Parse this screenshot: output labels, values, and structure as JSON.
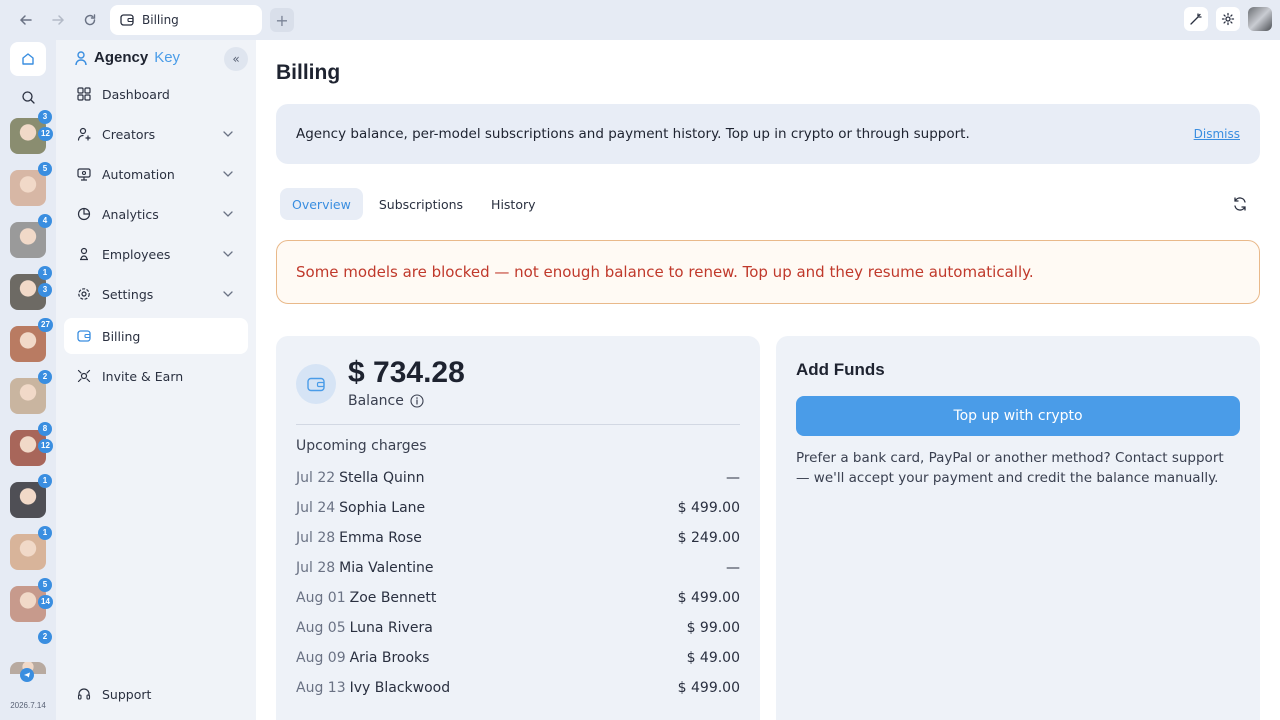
{
  "browser": {
    "tab_title": "Billing",
    "new_tab": "+"
  },
  "rail": {
    "version": "2026.7.14",
    "avatars": [
      {
        "badges": [
          "3",
          "12"
        ],
        "color": "#8a8d70"
      },
      {
        "badges": [
          "5"
        ],
        "color": "#d7b7a5"
      },
      {
        "badges": [
          "4"
        ],
        "color": "#9a9a9a"
      },
      {
        "badges": [
          "1",
          "3"
        ],
        "color": "#6d6a64"
      },
      {
        "badges": [
          "27"
        ],
        "color": "#b97b62"
      },
      {
        "badges": [
          "2"
        ],
        "color": "#c9b5a0"
      },
      {
        "badges": [
          "8",
          "12"
        ],
        "color": "#a8665a"
      },
      {
        "badges": [
          "1"
        ],
        "color": "#4f4f55"
      },
      {
        "badges": [
          "1"
        ],
        "color": "#d8b49a"
      },
      {
        "badges": [
          "5",
          "14"
        ],
        "color": "#c79a8c"
      },
      {
        "badges": [
          "2"
        ],
        "color": "#b8aaa0"
      }
    ]
  },
  "sidebar": {
    "brand_main": "Agency",
    "brand_accent": "Key",
    "items": [
      {
        "label": "Dashboard",
        "icon": "grid-icon"
      },
      {
        "label": "Creators",
        "icon": "user-icon"
      },
      {
        "label": "Automation",
        "icon": "automation-icon"
      },
      {
        "label": "Analytics",
        "icon": "pie-icon"
      },
      {
        "label": "Employees",
        "icon": "employee-icon"
      },
      {
        "label": "Settings",
        "icon": "gear-icon"
      },
      {
        "label": "Billing",
        "icon": "wallet-icon"
      },
      {
        "label": "Invite & Earn",
        "icon": "invite-icon"
      }
    ],
    "support": "Support"
  },
  "main": {
    "title": "Billing",
    "banner_text": "Agency balance, per-model subscriptions and payment history. Top up in crypto or through support.",
    "dismiss": "Dismiss",
    "tabs": [
      "Overview",
      "Subscriptions",
      "History"
    ],
    "warning": "Some models are blocked — not enough balance to renew. Top up and they resume automatically.",
    "balance": {
      "amount": "$ 734.28",
      "label": "Balance",
      "upcoming_title": "Upcoming charges",
      "charges": [
        {
          "date": "Jul 22",
          "name": "Stella Quinn",
          "amount": "—"
        },
        {
          "date": "Jul 24",
          "name": "Sophia Lane",
          "amount": "$ 499.00"
        },
        {
          "date": "Jul 28",
          "name": "Emma Rose",
          "amount": "$ 249.00"
        },
        {
          "date": "Jul 28",
          "name": "Mia Valentine",
          "amount": "—"
        },
        {
          "date": "Aug 01",
          "name": "Zoe Bennett",
          "amount": "$ 499.00"
        },
        {
          "date": "Aug 05",
          "name": "Luna Rivera",
          "amount": "$ 99.00"
        },
        {
          "date": "Aug 09",
          "name": "Aria Brooks",
          "amount": "$ 49.00"
        },
        {
          "date": "Aug 13",
          "name": "Ivy Blackwood",
          "amount": "$ 499.00"
        }
      ]
    },
    "add_funds": {
      "title": "Add Funds",
      "button": "Top up with crypto",
      "text": "Prefer a bank card, PayPal or another method? Contact support — we'll accept your payment and credit the balance manually."
    }
  }
}
